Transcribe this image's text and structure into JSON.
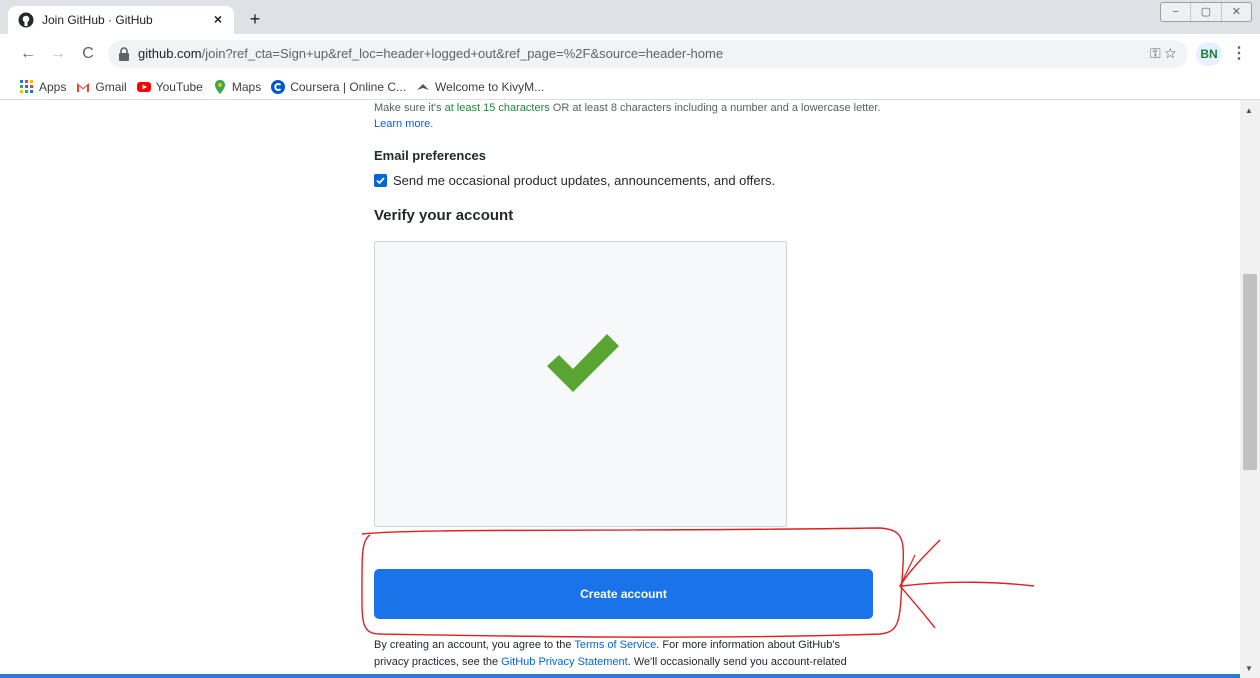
{
  "browser": {
    "tab_title": "Join GitHub · GitHub",
    "tab_close": "×",
    "new_tab": "+",
    "url_host": "github.com",
    "url_path": "/join?ref_cta=Sign+up&ref_loc=header+logged+out&ref_page=%2F&source=header-home",
    "profile_initials": "BN",
    "window_controls": [
      "−",
      "▢",
      "✕"
    ]
  },
  "bookmarks": [
    {
      "label": "Apps",
      "icon": "apps-grid-icon"
    },
    {
      "label": "Gmail",
      "icon": "gmail-icon"
    },
    {
      "label": "YouTube",
      "icon": "youtube-icon"
    },
    {
      "label": "Maps",
      "icon": "maps-icon"
    },
    {
      "label": "Coursera | Online C...",
      "icon": "coursera-icon"
    },
    {
      "label": "Welcome to KivyM...",
      "icon": "kivy-icon"
    }
  ],
  "page": {
    "password_hint_pre": "Make sure it's ",
    "password_hint_green": "at least 15 characters",
    "password_hint_post": " OR at least 8 characters including a number and a lowercase letter.",
    "learn_more": "Learn more.",
    "email_preferences": "Email preferences",
    "email_checkbox_label": "Send me occasional product updates, announcements, and offers.",
    "email_checkbox_checked": true,
    "verify_title": "Verify your account",
    "create_account": "Create account",
    "terms_1": "By creating an account, you agree to the ",
    "terms_link": "Terms of Service",
    "terms_2": ". For more information about GitHub's privacy practices, see the ",
    "privacy_link": "GitHub Privacy Statement",
    "terms_3": ". We'll occasionally send you account-related emails."
  },
  "colors": {
    "primary_button": "#1a73e8",
    "checkmark": "#58a631",
    "annotation": "#e02020",
    "link": "#0366d6"
  }
}
